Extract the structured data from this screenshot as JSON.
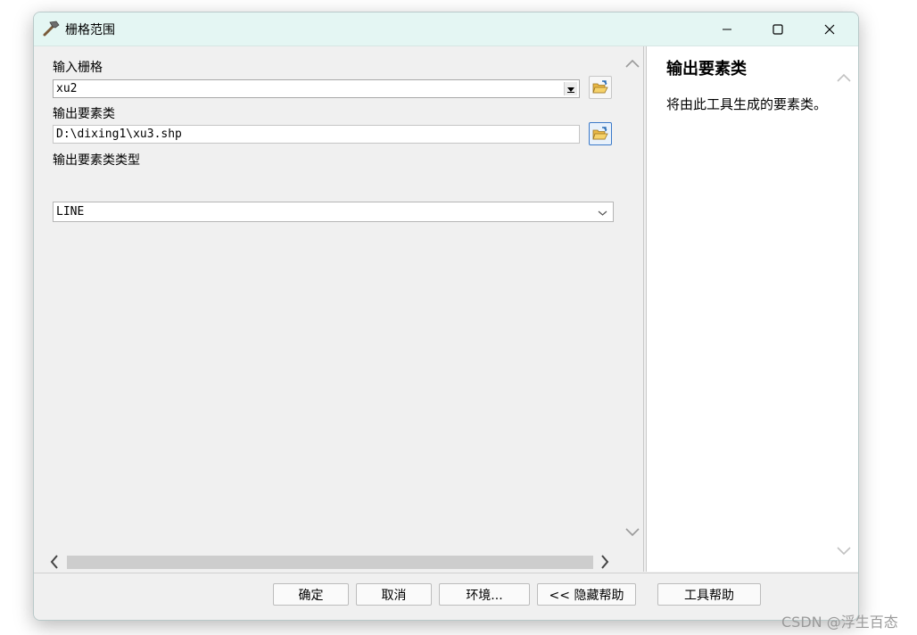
{
  "window": {
    "title": "栅格范围",
    "icons": {
      "app": "hammer-icon",
      "minimize": "minimize-icon",
      "maximize": "maximize-icon",
      "close": "close-icon"
    }
  },
  "form": {
    "input_raster": {
      "label": "输入栅格",
      "value": "xu2"
    },
    "output_feature_class": {
      "label": "输出要素类",
      "value": "D:\\dixing1\\xu3.shp"
    },
    "output_type": {
      "label": "输出要素类类型",
      "value": "LINE"
    }
  },
  "help": {
    "title": "输出要素类",
    "body": "将由此工具生成的要素类。"
  },
  "footer": {
    "ok": "确定",
    "cancel": "取消",
    "environments": "环境...",
    "hide_help": "<< 隐藏帮助",
    "tool_help": "工具帮助"
  },
  "watermark": "CSDN @浮生百态"
}
